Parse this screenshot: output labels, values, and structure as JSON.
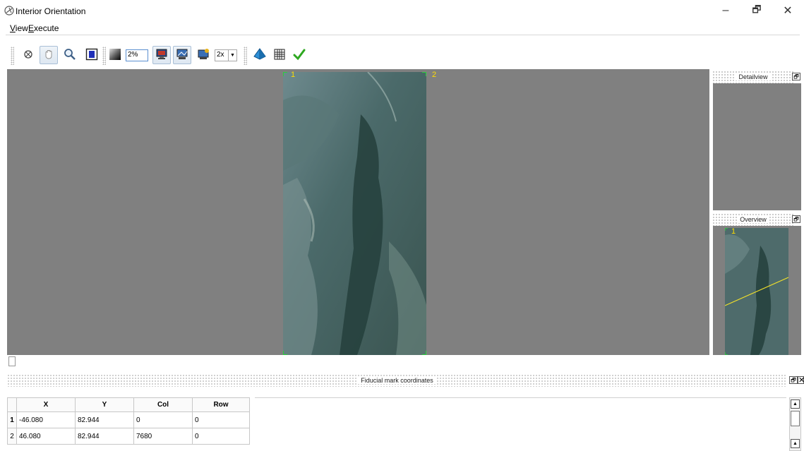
{
  "window": {
    "title": "Interior Orientation",
    "minimize_glyph": "–",
    "maximize_glyph": "🗗",
    "close_glyph": "✕"
  },
  "menu": {
    "view": "View",
    "execute": "Execute"
  },
  "toolbar": {
    "zoom_value": "2%",
    "oversampling_value": "2x",
    "icons": [
      "reset-view-icon",
      "pan-hand-icon",
      "zoom-magnifier-icon",
      "fit-to-window-icon",
      "contrast-icon",
      "zoom-percent-input",
      "display-monitor-icon",
      "image-monitor-icon",
      "image-monitor-star-icon",
      "oversampling-select",
      "pyramid-icon",
      "grid-table-icon",
      "apply-checkmark-icon"
    ]
  },
  "viewer": {
    "fiducial_label_1": "1",
    "fiducial_label_2": "2",
    "mark_color": "#ffdd00",
    "background_color": "#808080"
  },
  "docks": {
    "detailview_title": "Detailview",
    "overview_title": "Overview",
    "overview_fiducial_label": "1",
    "float_glyph": "🗗"
  },
  "fiducial_dock": {
    "title": "Fiducial mark coordinates",
    "close_glyph": "✕"
  },
  "table": {
    "columns": [
      "X",
      "Y",
      "Col",
      "Row"
    ],
    "rows": [
      {
        "index": "1",
        "x": "-46.080",
        "y": "82.944",
        "col": "0",
        "row": "0"
      },
      {
        "index": "2",
        "x": "46.080",
        "y": "82.944",
        "col": "7680",
        "row": "0"
      }
    ]
  },
  "colors": {
    "fiducial_yellow": "#ffdd00",
    "checkmark_green": "#2ea820",
    "viewer_gray": "#808080"
  }
}
